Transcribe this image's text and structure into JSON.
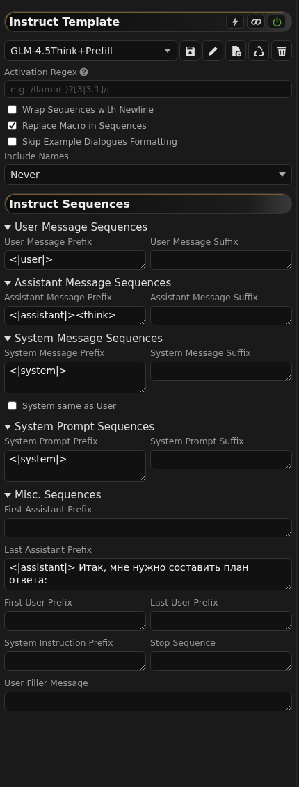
{
  "panel": {
    "title": "Instruct Template",
    "header_buttons": [
      {
        "kind": "bolt"
      },
      {
        "kind": "link"
      },
      {
        "kind": "power",
        "on": true
      }
    ]
  },
  "preset": {
    "value": "GLM-4.5Think+Prefill",
    "actions": [
      {
        "kind": "save"
      },
      {
        "kind": "edit"
      },
      {
        "kind": "new-file"
      },
      {
        "kind": "recycle"
      },
      {
        "kind": "delete"
      }
    ]
  },
  "activation_regex": {
    "label": "Activation Regex",
    "placeholder": "e.g. /llama(-)?[3|3.1]/i"
  },
  "options": [
    {
      "label": "Wrap Sequences with Newline",
      "checked": false
    },
    {
      "label": "Replace Macro in Sequences",
      "checked": true
    },
    {
      "label": "Skip Example Dialogues Formatting",
      "checked": false
    }
  ],
  "include_names": {
    "label": "Include Names",
    "value": "Never"
  },
  "sequences": {
    "title": "Instruct Sequences",
    "groups": [
      {
        "title": "User Message Sequences",
        "expanded": true,
        "rows": [
          [
            {
              "label": "User Message Prefix",
              "value": "<|user|>",
              "kind": "line"
            },
            {
              "label": "User Message Suffix",
              "kind": "line"
            }
          ]
        ]
      },
      {
        "title": "Assistant Message Sequences",
        "expanded": true,
        "rows": [
          [
            {
              "label": "Assistant Message Prefix",
              "value": "<|assistant|><think>",
              "kind": "line"
            },
            {
              "label": "Assistant Message Suffix",
              "kind": "line"
            }
          ]
        ]
      },
      {
        "title": "System Message Sequences",
        "expanded": true,
        "rows": [
          [
            {
              "label": "System Message Prefix",
              "value": "<|system|>",
              "kind": "multiline"
            },
            {
              "label": "System Message Suffix",
              "kind": "line"
            }
          ]
        ],
        "options": [
          {
            "label": "System same as User",
            "checked": false
          }
        ]
      },
      {
        "title": "System Prompt Sequences",
        "expanded": true,
        "rows": [
          [
            {
              "label": "System Prompt Prefix",
              "value": "<|system|>",
              "kind": "multiline"
            },
            {
              "label": "System Prompt Suffix",
              "kind": "line"
            }
          ]
        ]
      },
      {
        "title": "Misc. Sequences",
        "expanded": true,
        "rows": [
          [
            {
              "label": "First Assistant Prefix",
              "kind": "line"
            }
          ],
          [
            {
              "label": "Last Assistant Prefix",
              "value": "<|assistant|> Итак, мне нужно составить план ответа:",
              "kind": "multiline"
            }
          ],
          [
            {
              "label": "First User Prefix",
              "kind": "line"
            },
            {
              "label": "Last User Prefix",
              "kind": "line"
            }
          ],
          [
            {
              "label": "System Instruction Prefix",
              "kind": "line"
            },
            {
              "label": "Stop Sequence",
              "kind": "line"
            }
          ],
          [
            {
              "label": "User Filler Message",
              "kind": "line"
            }
          ]
        ]
      }
    ]
  }
}
